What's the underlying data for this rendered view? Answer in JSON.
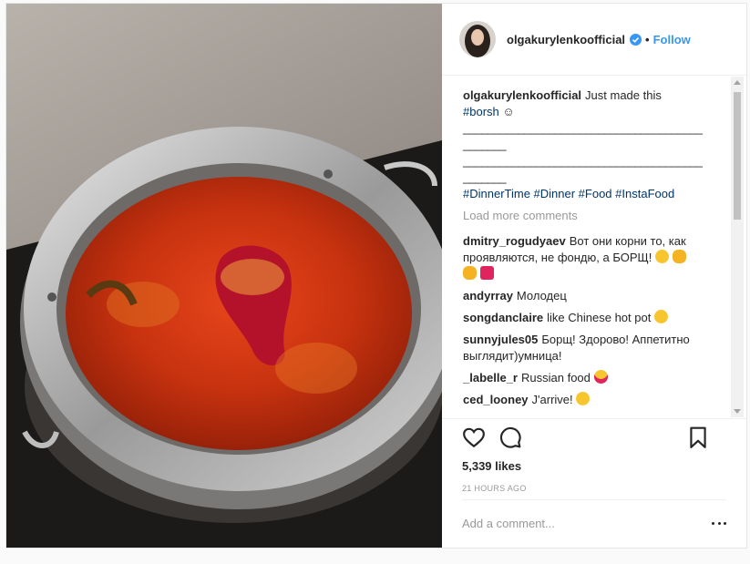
{
  "header": {
    "username": "olgakurylenkoofficial",
    "follow_label": "Follow",
    "separator": "•"
  },
  "caption": {
    "username": "olgakurylenkoofficial",
    "text": "Just made this",
    "hashtag": "#borsh",
    "emoji": "☺",
    "sep_lines": [
      "_______________________________________",
      "_______",
      "_______________________________________",
      "_______"
    ],
    "hashtags": "#DinnerTime #Dinner #Food #InstaFood"
  },
  "load_more": "Load more comments",
  "comments": [
    {
      "user": "dmitry_rogudyaev",
      "text": "Вот они корни то, как проявляются, не фондю, а БОРЩ!"
    },
    {
      "user": "andyrray",
      "text": "Молодец"
    },
    {
      "user": "songdanclaire",
      "text": "like Chinese hot pot"
    },
    {
      "user": "sunnyjules05",
      "text": "Борщ! Здорово! Аппетитно выглядит)умница!"
    },
    {
      "user": "_labelle_r",
      "text": "Russian food"
    },
    {
      "user": "ced_looney",
      "text": "J'arrive!"
    }
  ],
  "actions": {
    "icons": [
      "heart-icon",
      "comment-icon",
      "bookmark-icon"
    ]
  },
  "likes": "5,339 likes",
  "timestamp": "21 HOURS AGO",
  "add_comment": {
    "placeholder": "Add a comment..."
  },
  "colors": {
    "link": "#3897f0",
    "hashtag": "#003569",
    "muted": "#999999",
    "border": "#efefef"
  }
}
